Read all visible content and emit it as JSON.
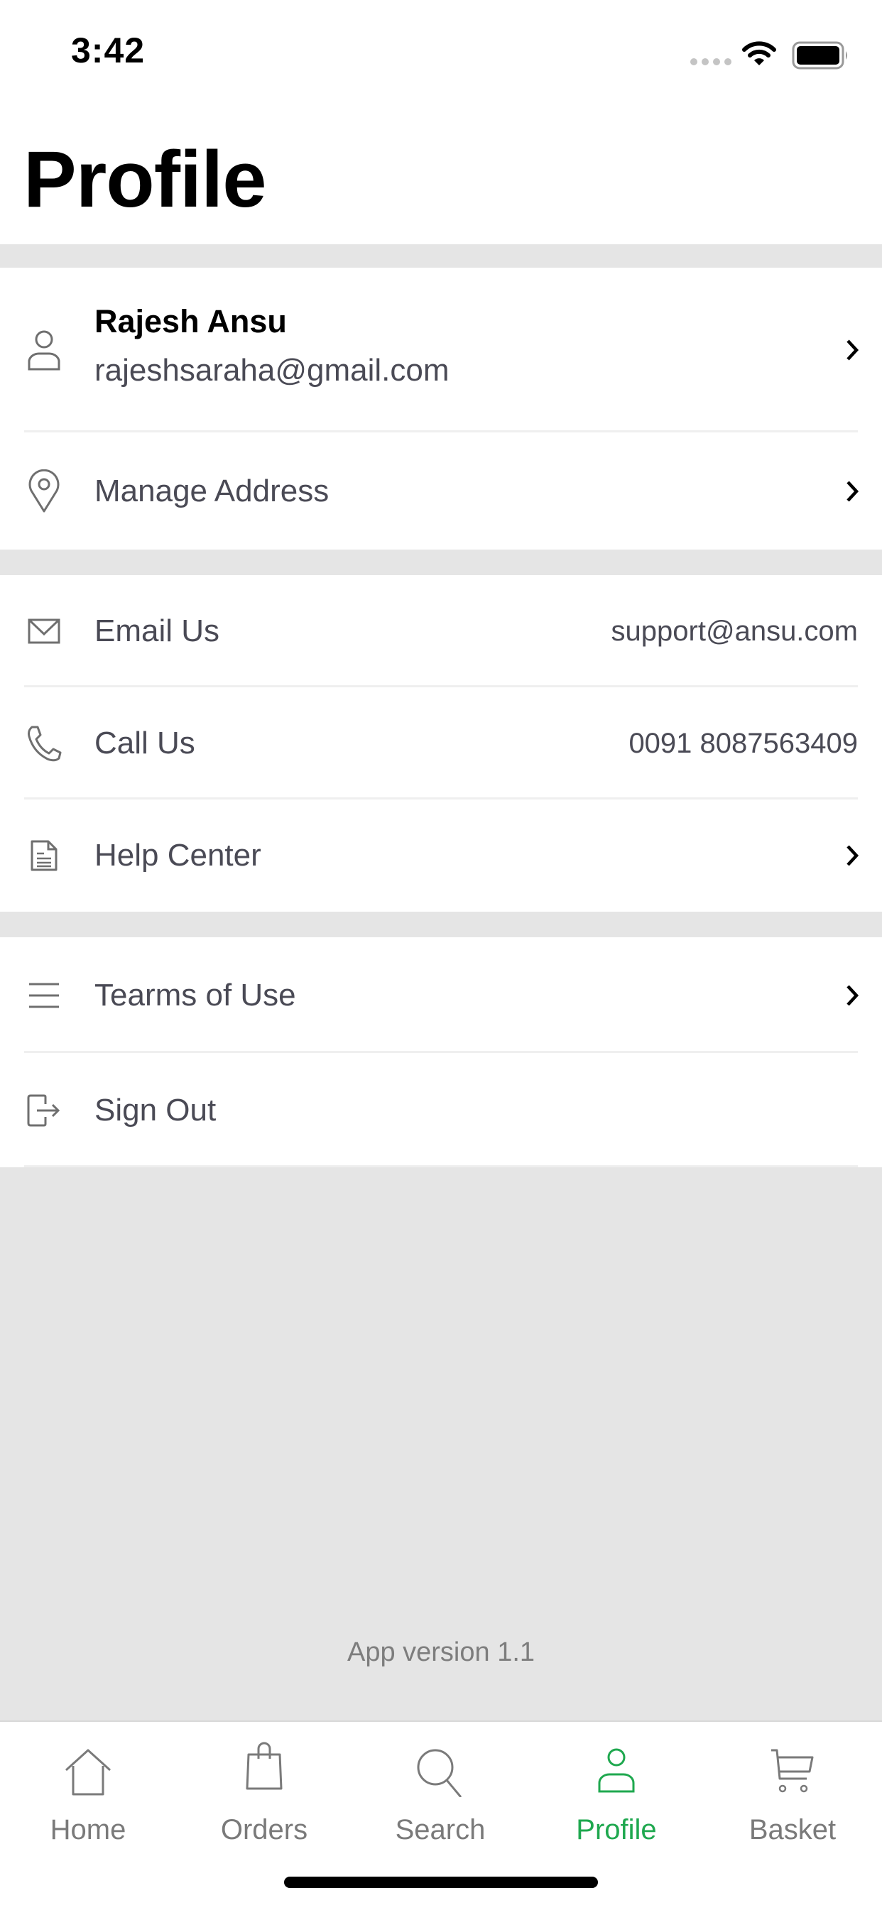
{
  "status_bar": {
    "time": "3:42",
    "signal_icon": "signal-dots-icon",
    "wifi_icon": "wifi-icon",
    "battery_icon": "battery-full-icon"
  },
  "header": {
    "title": "Profile"
  },
  "account": {
    "name": "Rajesh Ansu",
    "email": "rajeshsaraha@gmail.com",
    "icon": "person-icon",
    "manage_address": {
      "label": "Manage Address",
      "icon": "location-pin-icon"
    }
  },
  "contact": {
    "email": {
      "label": "Email Us",
      "value": "support@ansu.com",
      "icon": "envelope-icon"
    },
    "call": {
      "label": "Call Us",
      "value": "0091 8087563409",
      "icon": "phone-icon"
    },
    "help": {
      "label": "Help Center",
      "icon": "document-icon"
    }
  },
  "legal": {
    "terms": {
      "label": "Tearms of Use",
      "icon": "list-icon"
    },
    "signout": {
      "label": "Sign Out",
      "icon": "sign-out-icon"
    }
  },
  "footer": {
    "version": "App version 1.1"
  },
  "tabbar": {
    "active_color": "#1fa84f",
    "inactive_color": "#7a7a7a",
    "tabs": [
      {
        "label": "Home",
        "icon": "home-icon"
      },
      {
        "label": "Orders",
        "icon": "shopping-bag-icon"
      },
      {
        "label": "Search",
        "icon": "search-icon"
      },
      {
        "label": "Profile",
        "icon": "person-icon",
        "active": true
      },
      {
        "label": "Basket",
        "icon": "cart-icon"
      }
    ]
  }
}
